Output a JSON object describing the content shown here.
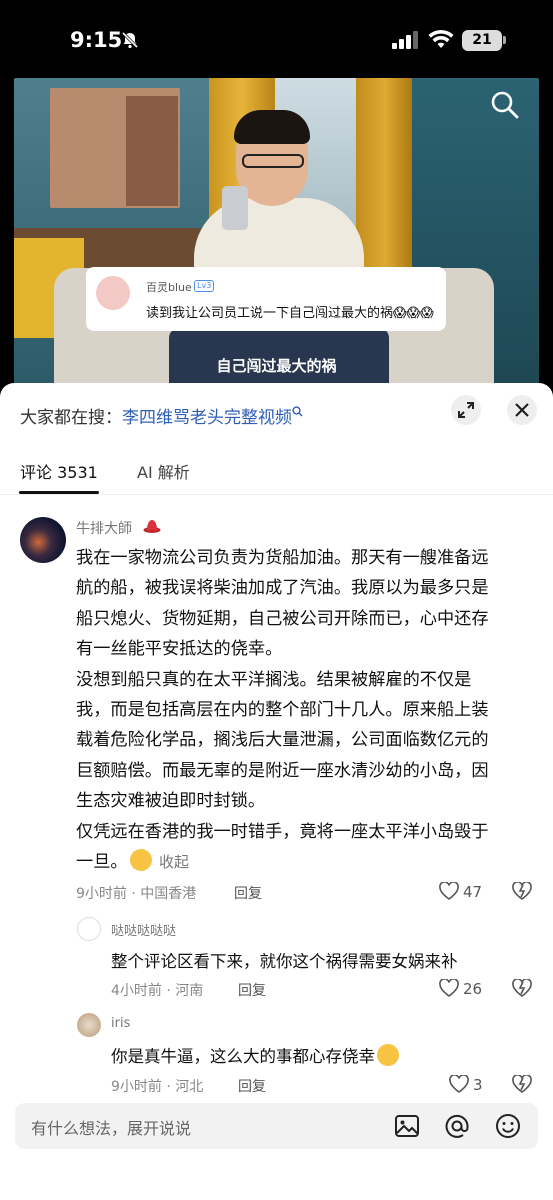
{
  "status_bar": {
    "time": "9:15",
    "battery": "21"
  },
  "video": {
    "overlay_username": "百灵blue",
    "overlay_level": "Lv3",
    "overlay_text": "读到我让公司员工说一下自己闯过最大的祸😱😱😱",
    "caption": "自己闯过最大的祸"
  },
  "hot_search": {
    "prefix": "大家都在搜：",
    "keyword": "李四维骂老头完整视频"
  },
  "tabs": [
    {
      "label": "评论 3531"
    },
    {
      "label": "AI 解析"
    }
  ],
  "comment": {
    "username": "牛排大師",
    "paragraphs": [
      "我在一家物流公司负责为货船加油。那天有一艘准备远\n航的船，被我误将柴油加成了汽油。我原以为最多只是\n船只熄火、货物延期，自己被公司开除而已，心中还存\n有一丝能平安抵达的侥幸。",
      "没想到船只真的在太平洋搁浅。结果被解雇的不仅是\n我，而是包括高层在内的整个部门十几人。原来船上装\n载着危险化学品，搁浅后大量泄漏，公司面临数亿元的\n巨额赔偿。而最无辜的是附近一座水清沙幼的小岛，因\n生态灾难被迫即时封锁。",
      "仅凭远在香港的我一时错手，竟将一座太平洋小岛毁于\n一旦。"
    ],
    "collapse_label": "收起",
    "meta": "9小时前 · 中国香港",
    "reply_label": "回复",
    "likes": "47"
  },
  "replies": [
    {
      "username": "哒哒哒哒哒",
      "text": "整个评论区看下来，就你这个祸得需要女娲来补",
      "meta": "4小时前 · 河南",
      "reply_label": "回复",
      "likes": "26"
    },
    {
      "username": "iris",
      "text": "你是真牛逼，这么大的事都心存侥幸",
      "meta": "9小时前 · 河北",
      "reply_label": "回复",
      "likes": "3"
    }
  ],
  "input": {
    "placeholder": "有什么想法，展开说说"
  },
  "colors": {
    "link": "#2e5fb8",
    "panel": "#ffffff",
    "input_bg": "#f2f2f2"
  }
}
